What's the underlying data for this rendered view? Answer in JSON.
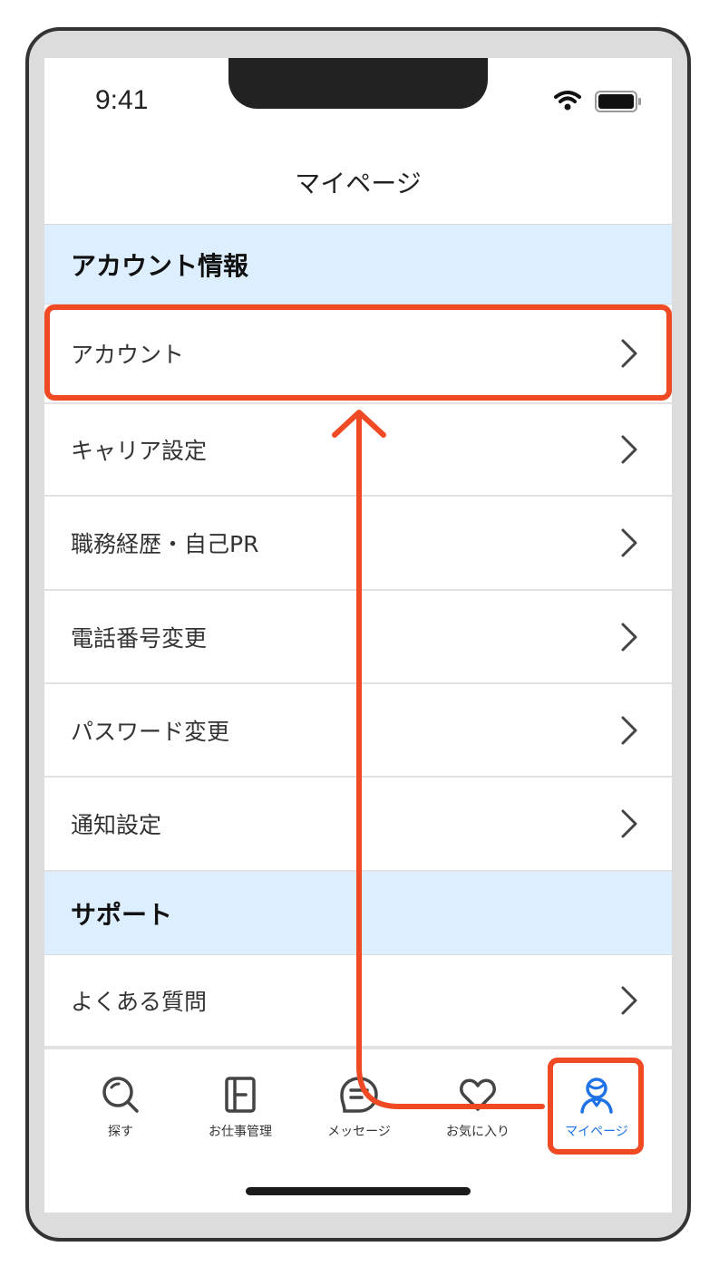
{
  "status_bar": {
    "time": "9:41",
    "wifi_icon": "wifi-icon",
    "battery_icon": "battery-icon"
  },
  "nav": {
    "title": "マイページ"
  },
  "sections": [
    {
      "title": "アカウント情報",
      "items": [
        {
          "label": "アカウント"
        },
        {
          "label": "キャリア設定"
        },
        {
          "label": "職務経歴・自己PR"
        },
        {
          "label": "電話番号変更"
        },
        {
          "label": "パスワード変更"
        },
        {
          "label": "通知設定"
        }
      ]
    },
    {
      "title": "サポート",
      "items": [
        {
          "label": "よくある質問"
        }
      ]
    }
  ],
  "tabs": [
    {
      "label": "探す",
      "icon": "search-icon"
    },
    {
      "label": "お仕事管理",
      "icon": "job-manage-icon"
    },
    {
      "label": "メッセージ",
      "icon": "message-icon"
    },
    {
      "label": "お気に入り",
      "icon": "heart-icon"
    },
    {
      "label": "マイページ",
      "icon": "user-icon",
      "active": true
    }
  ],
  "colors": {
    "accent": "#1f73e6",
    "highlight": "#ef4a23",
    "section_bg": "#ddeeff"
  }
}
